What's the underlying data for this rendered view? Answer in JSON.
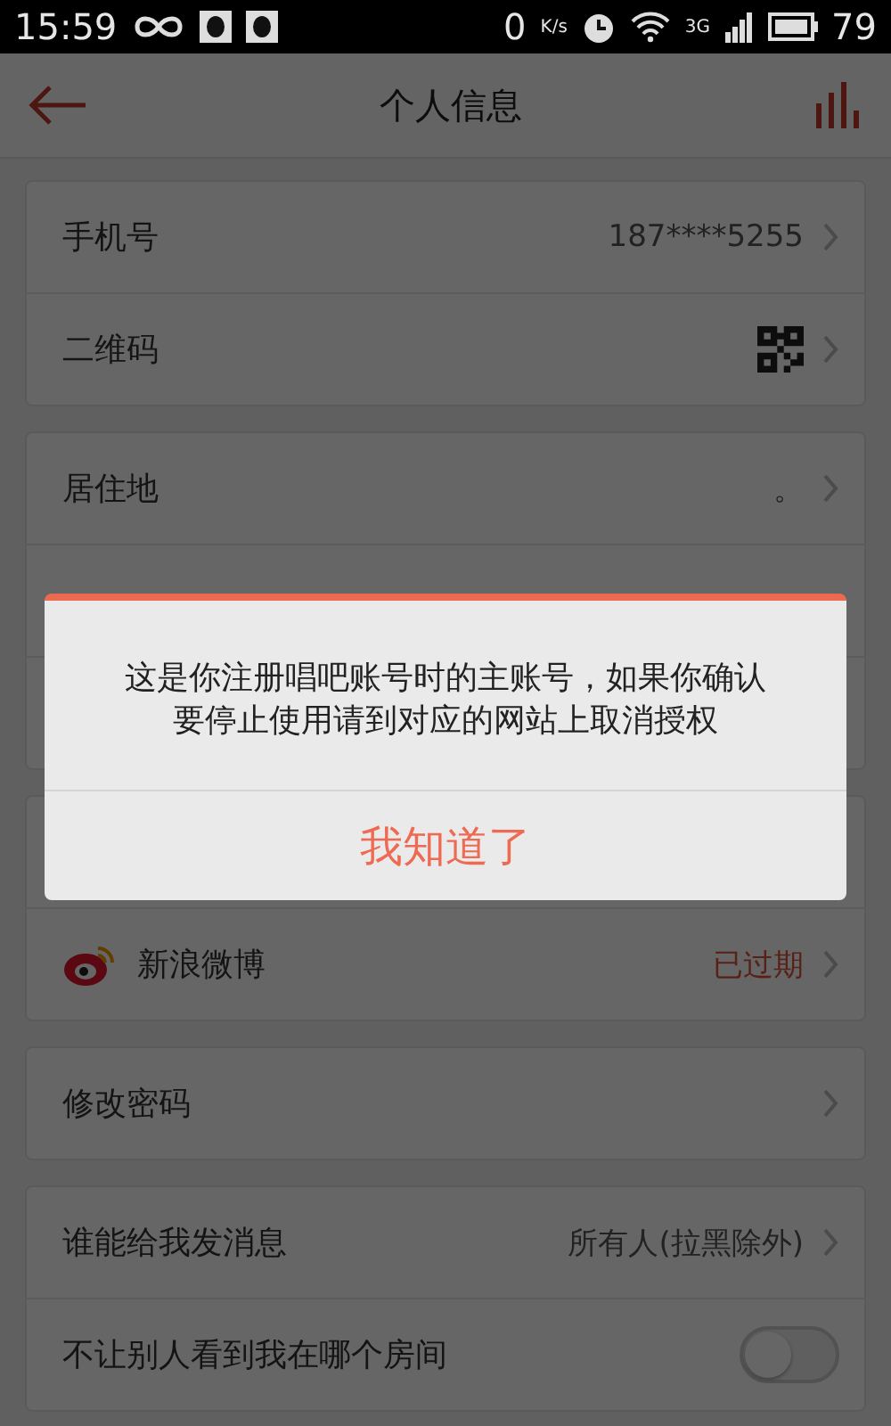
{
  "status_bar": {
    "time": "15:59",
    "speed": "0",
    "speed_unit": "K/s",
    "network": "3G",
    "battery": "79"
  },
  "header": {
    "title": "个人信息"
  },
  "groups": [
    {
      "rows": [
        {
          "kind": "value",
          "label": "手机号",
          "value": "187****5255"
        },
        {
          "kind": "qr",
          "label": "二维码"
        }
      ]
    },
    {
      "rows": [
        {
          "kind": "value",
          "label": "居住地",
          "value": "。"
        },
        {
          "kind": "hidden"
        },
        {
          "kind": "hidden"
        }
      ]
    },
    {
      "rows": [
        {
          "kind": "hidden"
        },
        {
          "kind": "weibo",
          "label": "新浪微博",
          "value": "已过期"
        }
      ]
    },
    {
      "rows": [
        {
          "kind": "value",
          "label": "修改密码"
        }
      ]
    },
    {
      "rows": [
        {
          "kind": "value",
          "label": "谁能给我发消息",
          "value": "所有人(拉黑除外)"
        },
        {
          "kind": "toggle",
          "label": "不让别人看到我在哪个房间",
          "on": false
        }
      ]
    }
  ],
  "dialog": {
    "message": "这是你注册唱吧账号时的主账号，如果你确认要停止使用请到对应的网站上取消授权",
    "button": "我知道了"
  }
}
